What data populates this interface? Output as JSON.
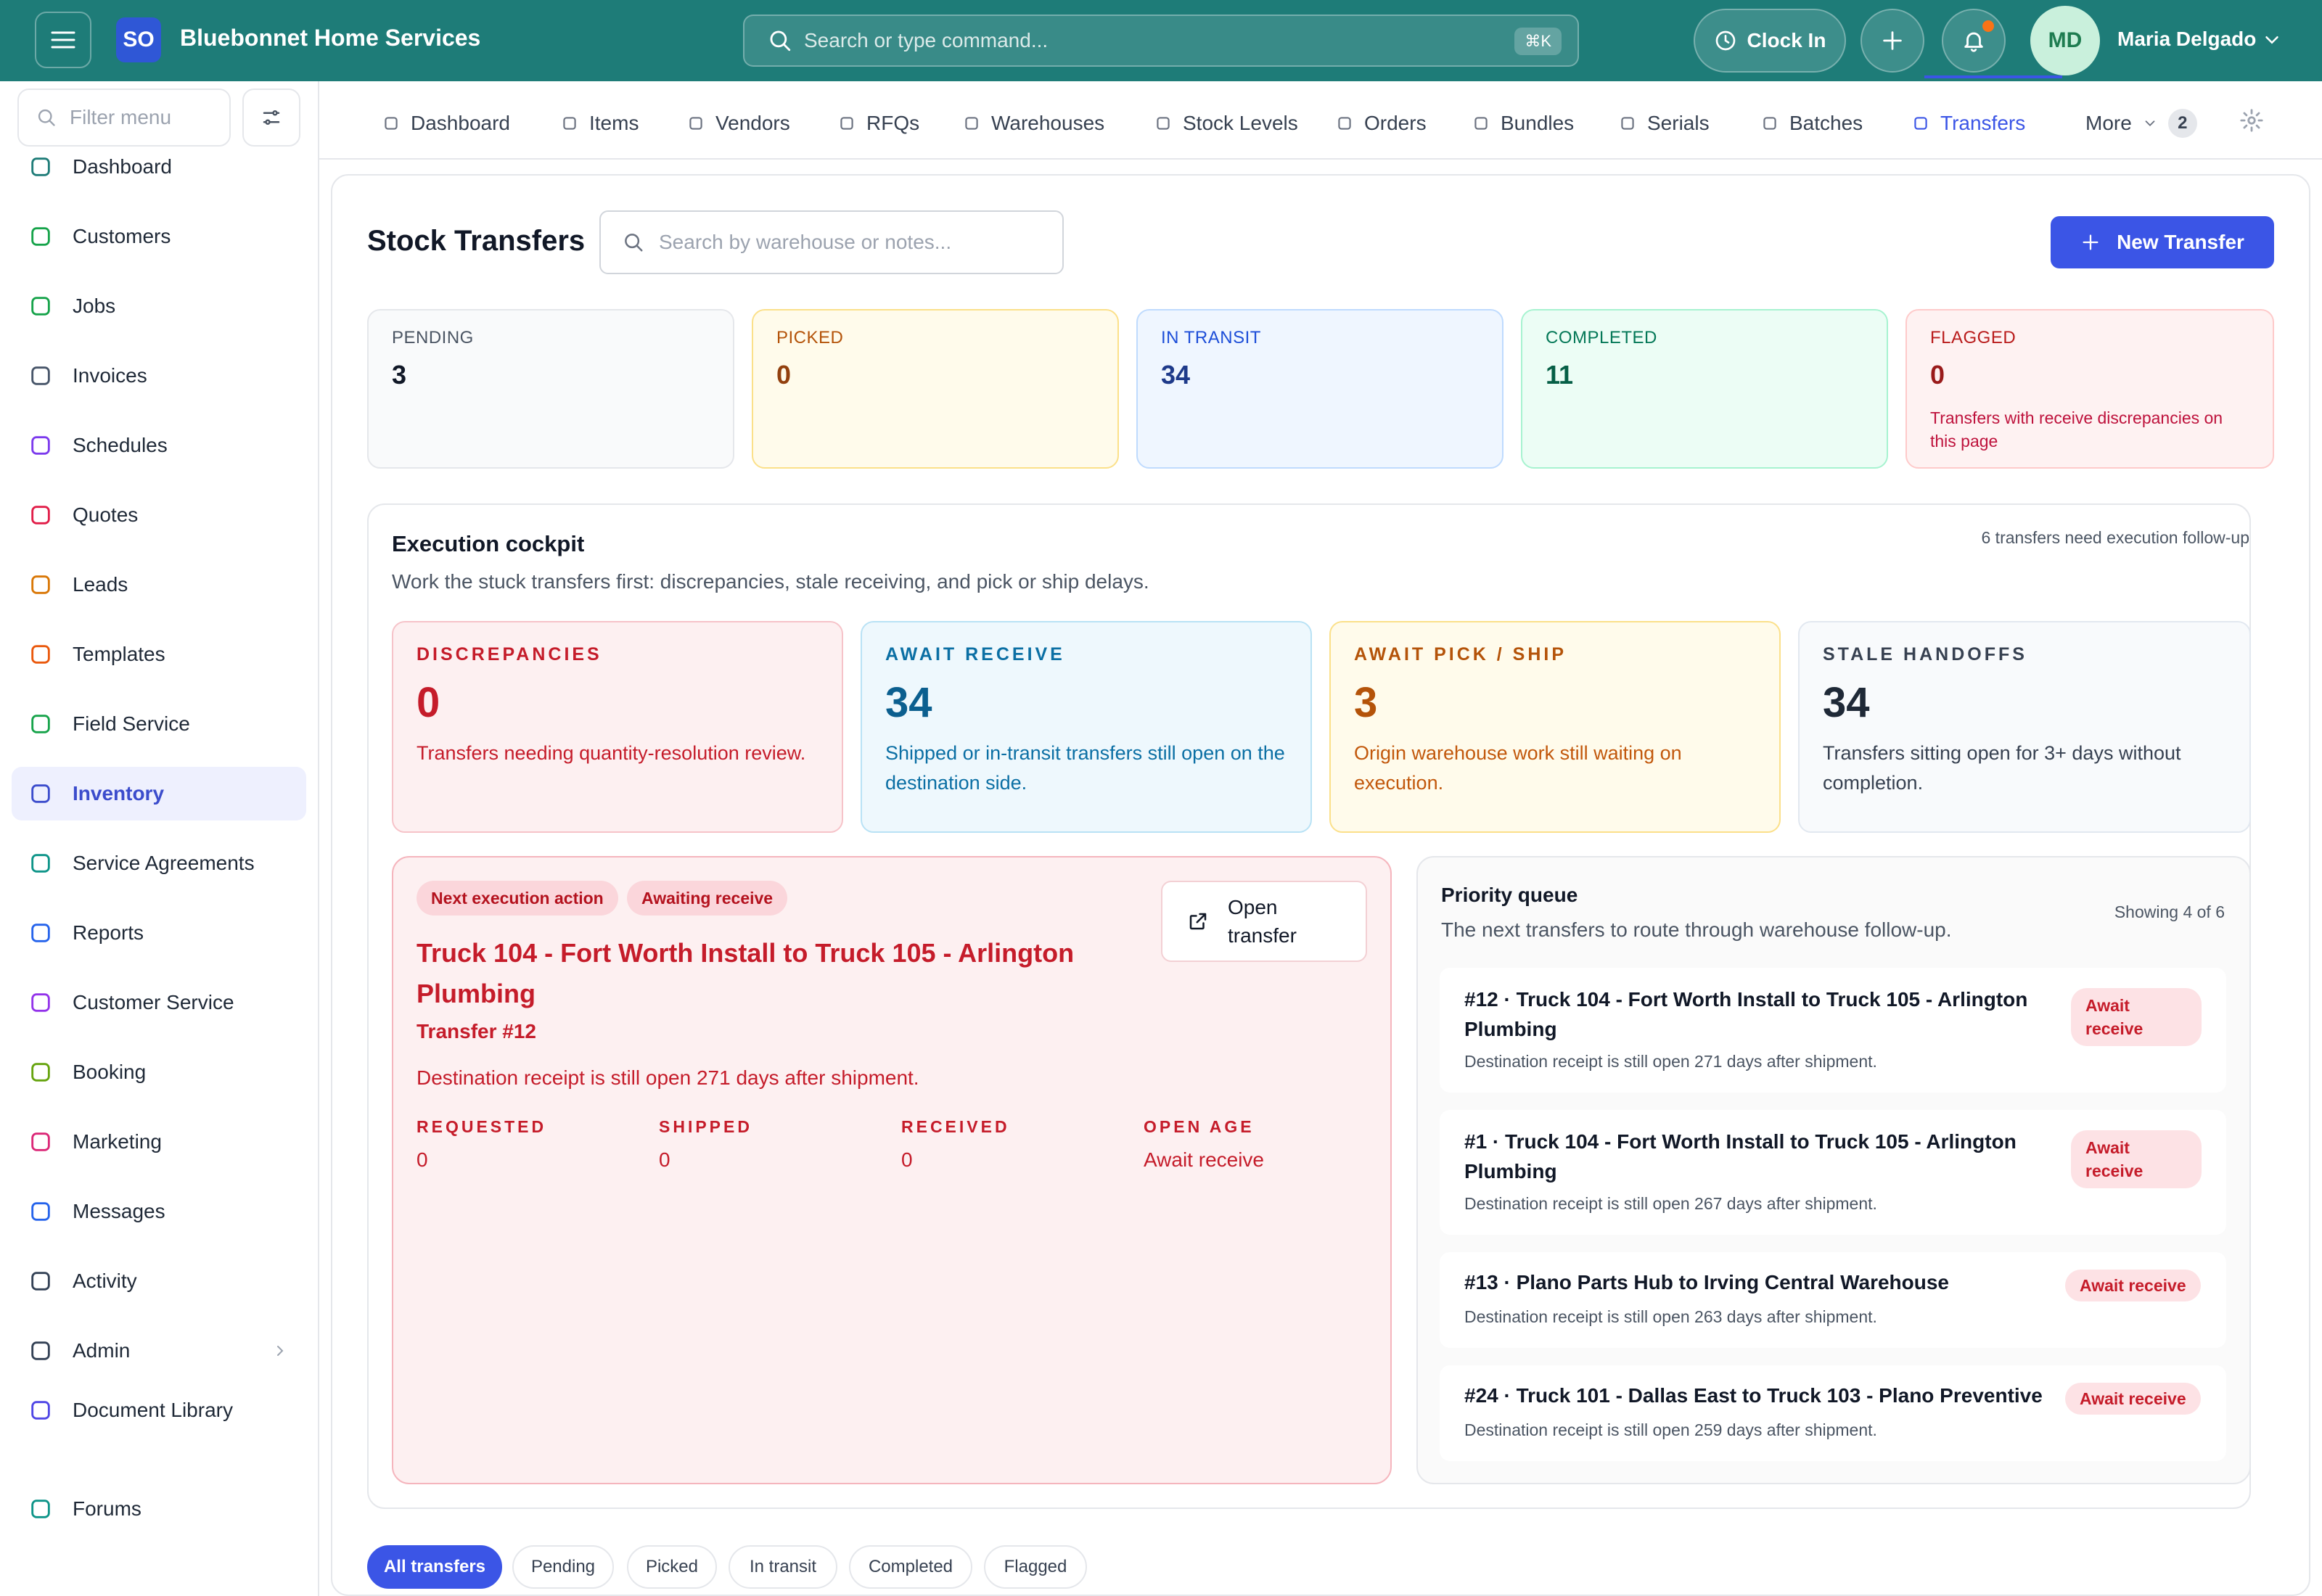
{
  "app": {
    "logo_text": "SO",
    "brand": "Bluebonnet Home Services",
    "search_placeholder": "Search or type command...",
    "shortcut": "⌘K",
    "clock_in": "Clock In",
    "user_initials": "MD",
    "user_name": "Maria Delgado"
  },
  "sidebar": {
    "filter_placeholder": "Filter menu",
    "items": [
      {
        "label": "Dashboard",
        "icon": "home-icon"
      },
      {
        "label": "Customers",
        "icon": "users-icon"
      },
      {
        "label": "Jobs",
        "icon": "briefcase-icon"
      },
      {
        "label": "Invoices",
        "icon": "invoice-icon"
      },
      {
        "label": "Schedules",
        "icon": "calendar-icon"
      },
      {
        "label": "Quotes",
        "icon": "document-icon"
      },
      {
        "label": "Leads",
        "icon": "funnel-icon"
      },
      {
        "label": "Templates",
        "icon": "template-icon"
      },
      {
        "label": "Field Service",
        "icon": "wrench-icon"
      },
      {
        "label": "Inventory",
        "icon": "box-icon"
      },
      {
        "label": "Service Agreements",
        "icon": "agreement-icon"
      },
      {
        "label": "Reports",
        "icon": "bar-chart-icon"
      },
      {
        "label": "Customer Service",
        "icon": "headset-icon"
      },
      {
        "label": "Booking",
        "icon": "calendar-check-icon"
      },
      {
        "label": "Marketing",
        "icon": "megaphone-icon"
      },
      {
        "label": "Messages",
        "icon": "chat-icon"
      },
      {
        "label": "Activity",
        "icon": "history-icon"
      },
      {
        "label": "Admin",
        "icon": "shield-icon"
      },
      {
        "label": "Document Library",
        "icon": "library-icon"
      },
      {
        "label": "Forums",
        "icon": "forum-icon"
      }
    ]
  },
  "tabs": {
    "items": [
      {
        "label": "Dashboard",
        "icon": "gauge-icon"
      },
      {
        "label": "Items",
        "icon": "cube-icon"
      },
      {
        "label": "Vendors",
        "icon": "store-icon"
      },
      {
        "label": "RFQs",
        "icon": "file-icon"
      },
      {
        "label": "Warehouses",
        "icon": "warehouse-icon"
      },
      {
        "label": "Stock Levels",
        "icon": "stock-chart-icon"
      },
      {
        "label": "Orders",
        "icon": "cart-icon"
      },
      {
        "label": "Bundles",
        "icon": "layers-icon"
      },
      {
        "label": "Serials",
        "icon": "scan-icon"
      },
      {
        "label": "Batches",
        "icon": "stack-icon"
      },
      {
        "label": "Transfers",
        "icon": "transfer-icon"
      }
    ],
    "more_label": "More",
    "more_count": "2"
  },
  "page": {
    "title": "Stock Transfers",
    "search_placeholder": "Search by warehouse or notes...",
    "new_button": "New Transfer"
  },
  "stats": [
    {
      "label": "PENDING",
      "value": "3",
      "note": ""
    },
    {
      "label": "PICKED",
      "value": "0",
      "note": ""
    },
    {
      "label": "IN TRANSIT",
      "value": "34",
      "note": ""
    },
    {
      "label": "COMPLETED",
      "value": "11",
      "note": ""
    },
    {
      "label": "FLAGGED",
      "value": "0",
      "note": "Transfers with receive discrepancies on this page"
    }
  ],
  "cockpit": {
    "title": "Execution cockpit",
    "subtitle": "Work the stuck transfers first: discrepancies, stale receiving, and pick or ship delays.",
    "follow_up": "6 transfers need execution follow-up",
    "kpis": [
      {
        "label": "DISCREPANCIES",
        "value": "0",
        "desc": "Transfers needing quantity-resolution review."
      },
      {
        "label": "AWAIT RECEIVE",
        "value": "34",
        "desc": "Shipped or in-transit transfers still open on the destination side."
      },
      {
        "label": "AWAIT PICK / SHIP",
        "value": "3",
        "desc": "Origin warehouse work still waiting on execution."
      },
      {
        "label": "STALE HANDOFFS",
        "value": "34",
        "desc": "Transfers sitting open for 3+ days without completion."
      }
    ]
  },
  "next_action": {
    "tag1": "Next execution action",
    "tag2": "Awaiting receive",
    "open_line1": "Open",
    "open_line2": "transfer",
    "title": "Truck 104 - Fort Worth Install to Truck 105 - Arlington Plumbing",
    "transfer": "Transfer #12",
    "desc": "Destination receipt is still open 271 days after shipment.",
    "metrics": [
      {
        "label": "REQUESTED",
        "value": "0"
      },
      {
        "label": "SHIPPED",
        "value": "0"
      },
      {
        "label": "RECEIVED",
        "value": "0"
      },
      {
        "label": "OPEN AGE",
        "value": "Await receive"
      }
    ]
  },
  "priority_queue": {
    "title": "Priority queue",
    "subtitle": "The next transfers to route through warehouse follow-up.",
    "showing": "Showing 4 of 6",
    "items": [
      {
        "title": "#12 · Truck 104 - Fort Worth Install to Truck 105 - Arlington Plumbing",
        "desc": "Destination receipt is still open 271 days after shipment.",
        "badge": "Await receive"
      },
      {
        "title": "#1 · Truck 104 - Fort Worth Install to Truck 105 - Arlington Plumbing",
        "desc": "Destination receipt is still open 267 days after shipment.",
        "badge": "Await receive"
      },
      {
        "title": "#13 · Plano Parts Hub to Irving Central Warehouse",
        "desc": "Destination receipt is still open 263 days after shipment.",
        "badge": "Await receive"
      },
      {
        "title": "#24 · Truck 101 - Dallas East to Truck 103 - Plano Preventive",
        "desc": "Destination receipt is still open 259 days after shipment.",
        "badge": "Await receive"
      }
    ]
  },
  "filters": [
    "All transfers",
    "Pending",
    "Picked",
    "In transit",
    "Completed",
    "Flagged"
  ],
  "colors": {
    "topbar": "#1e7c78",
    "accent": "#3b55e6",
    "danger": "#c51c2a"
  }
}
